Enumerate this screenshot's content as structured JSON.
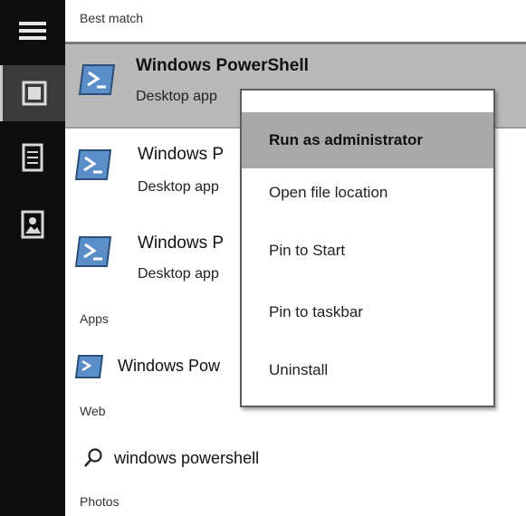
{
  "nav": {
    "items": [
      {
        "icon": "hamburger-icon"
      },
      {
        "icon": "home-icon"
      },
      {
        "icon": "document-icon"
      },
      {
        "icon": "photos-icon"
      }
    ]
  },
  "sections": {
    "best_match": "Best match",
    "apps": "Apps",
    "web": "Web",
    "photos": "Photos"
  },
  "results": [
    {
      "title": "Windows PowerShell",
      "subtitle": "Desktop app",
      "icon": "powershell-icon"
    },
    {
      "title": "Windows P",
      "subtitle": "Desktop app",
      "icon": "powershell-icon"
    },
    {
      "title": "Windows P",
      "subtitle": "Desktop app",
      "icon": "powershell-icon"
    }
  ],
  "apps": [
    {
      "title": "Windows Pow",
      "icon": "powershell-icon"
    }
  ],
  "web_search": {
    "icon": "search-icon",
    "query": "windows powershell"
  },
  "context_menu": [
    "Run as administrator",
    "Open file location",
    "Pin to Start",
    "Pin to taskbar",
    "Uninstall"
  ],
  "colors": {
    "rail": "#0d0d0d",
    "selected_row": "#b9b9b9",
    "menu_hover": "#a9a9a9",
    "icon_blue": "#5a8ec8"
  }
}
